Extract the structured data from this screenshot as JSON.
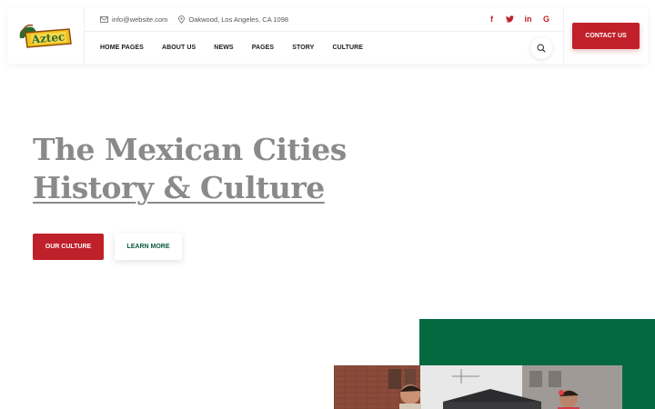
{
  "header": {
    "logo_text": "Aztec",
    "email": "info@website.com",
    "address": "Oakwood, Los Angeles, CA 1098",
    "social": [
      {
        "icon": "facebook-icon",
        "glyph": "f"
      },
      {
        "icon": "twitter-icon",
        "glyph": "t"
      },
      {
        "icon": "linkedin-icon",
        "glyph": "in"
      },
      {
        "icon": "google-icon",
        "glyph": "G"
      }
    ],
    "nav": [
      "HOME PAGES",
      "ABOUT US",
      "NEWS",
      "PAGES",
      "STORY",
      "CULTURE"
    ],
    "contact_label": "CONTACT US"
  },
  "hero": {
    "title_line1": "The Mexican Cities",
    "title_line2": "History & Culture",
    "primary_button": "OUR CULTURE",
    "secondary_button": "LEARN MORE"
  },
  "colors": {
    "accent_red": "#c0202a",
    "accent_green": "#05693f",
    "title_gray": "#8a8a8a"
  }
}
